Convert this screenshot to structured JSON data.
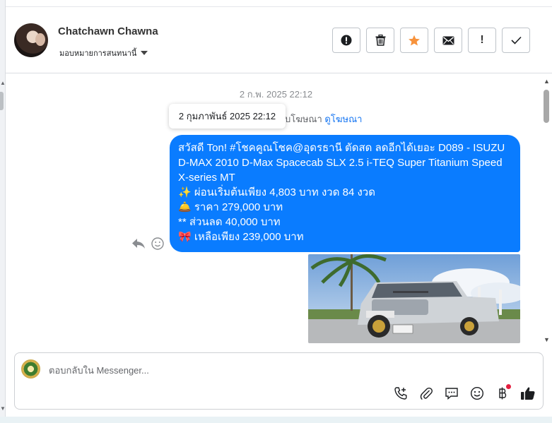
{
  "header": {
    "contact_name": "Chatchawn Chawna",
    "assign_label": "มอบหมายการสนทนานี้",
    "actions": [
      {
        "icon": "alert-circle-icon"
      },
      {
        "icon": "trash-icon"
      },
      {
        "icon": "star-icon",
        "color": "#f7923b"
      },
      {
        "icon": "envelope-icon"
      },
      {
        "icon": "exclamation-icon",
        "text": "!"
      },
      {
        "icon": "check-icon"
      }
    ]
  },
  "chat": {
    "date_separator": "2 ก.พ. 2025 22:12",
    "tooltip": "2 กุมภาพันธ์ 2025 22:12",
    "ad_line_prefix": "รับโฆษณา",
    "ad_link": "ดูโฆษณา",
    "message": {
      "line1": "สวัสดี Ton! #โชคคูณโชค@อุดรธานี ตัดสด ลดอีกได้เยอะ D089 - ISUZU D-MAX 2010 D-Max Spacecab SLX 2.5 i-TEQ Super Titanium Speed X-series MT",
      "line2": "✨ ผ่อนเริ่มต้นเพียง 4,803 บาท งวด 84 งวด",
      "line3": "🛎️  ราคา 279,000 บาท",
      "line4": "** ส่วนลด 40,000 บาท",
      "line5": "🎀 เหลือเพียง 239,000 บาท",
      "bubble_color": "#0a7cff"
    }
  },
  "composer": {
    "placeholder": "ตอบกลับใน Messenger...",
    "value": "",
    "tools": [
      "call-add-icon",
      "paperclip-icon",
      "saved-reply-icon",
      "emoji-icon",
      "baht-icon",
      "thumbs-up-icon"
    ]
  },
  "colors": {
    "accent": "#0a7cff",
    "link": "#1877f2",
    "star": "#f7923b",
    "notification_dot": "#e41e3f"
  }
}
